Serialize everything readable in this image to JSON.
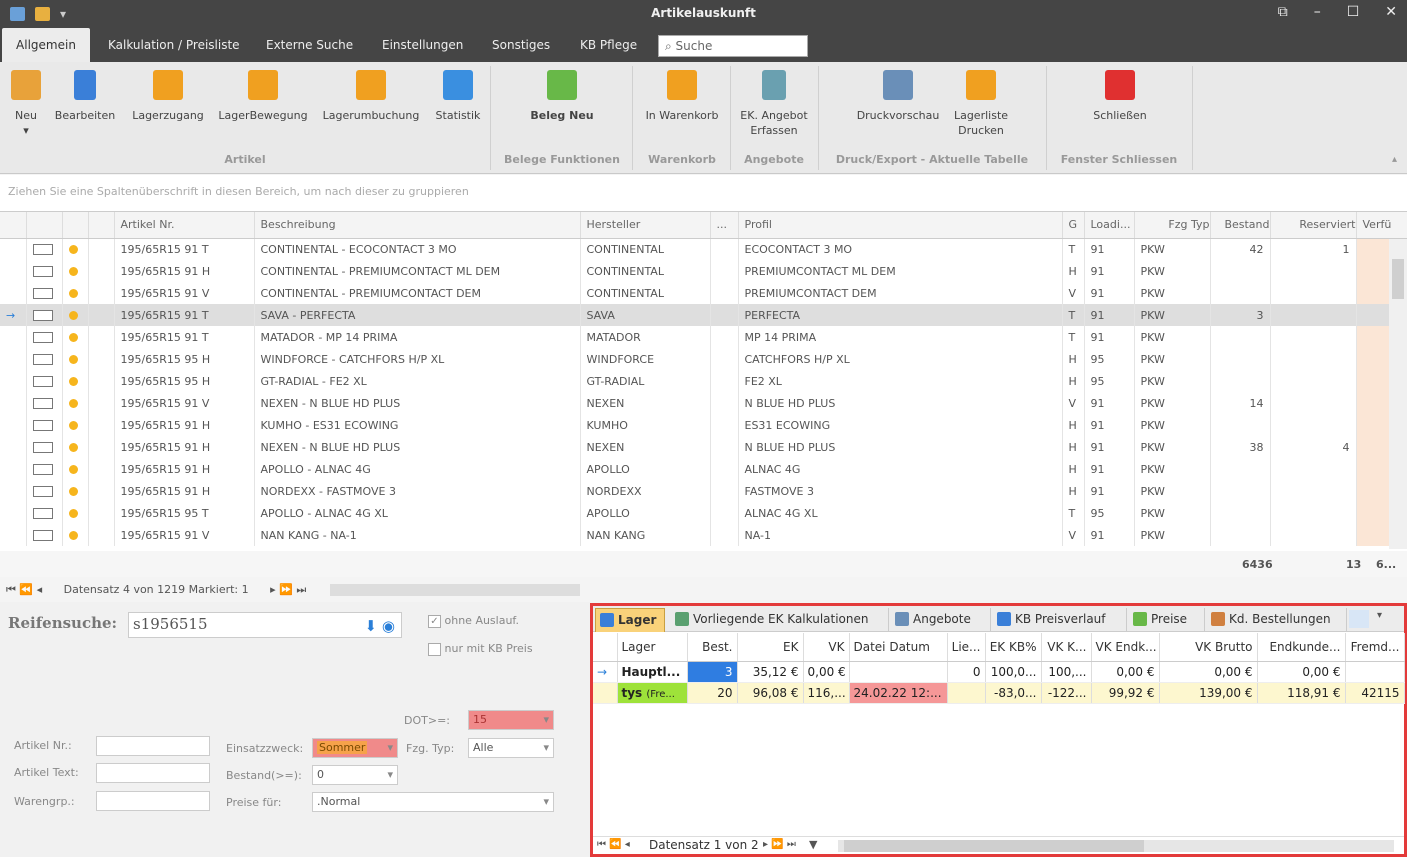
{
  "window": {
    "title": "Artikelauskunft",
    "min": "–",
    "max": "☐",
    "close": "✕",
    "restore": "⧉"
  },
  "menu": {
    "tabs": [
      "Allgemein",
      "Kalkulation / Preisliste",
      "Externe Suche",
      "Einstellungen",
      "Sonstiges",
      "KB Pflege"
    ],
    "search_placeholder": "Suche"
  },
  "ribbon": {
    "buttons": [
      {
        "label": "Neu",
        "color": "#e8a23a"
      },
      {
        "label": "Bearbeiten",
        "color": "#3a7fd8"
      },
      {
        "label": "Lagerzugang",
        "color": "#f0a020"
      },
      {
        "label": "LagerBewegung",
        "color": "#f0a020"
      },
      {
        "label": "Lagerumbuchung",
        "color": "#f0a020"
      },
      {
        "label": "Statistik",
        "color": "#3a8fe0"
      },
      {
        "label": "Beleg Neu",
        "color": "#68b848"
      },
      {
        "label": "In Warenkorb",
        "color": "#f0a020"
      },
      {
        "label": "EK. Angebot Erfassen",
        "color": "#6aa0b0"
      },
      {
        "label": "Druckvorschau",
        "color": "#6a8fb8"
      },
      {
        "label": "Lagerliste Drucken",
        "color": "#f0a020"
      },
      {
        "label": "Schließen",
        "color": "#e03030"
      }
    ],
    "groups": [
      "Artikel",
      "Belege Funktionen",
      "Warenkorb",
      "Angebote",
      "Druck/Export - Aktuelle Tabelle",
      "Fenster Schliessen"
    ]
  },
  "groupbar": "Ziehen Sie eine Spaltenüberschrift in diesen Bereich, um nach dieser zu gruppieren",
  "grid": {
    "columns": [
      "",
      "",
      "",
      "Artikel Nr.",
      "Beschreibung",
      "Hersteller",
      "...",
      "Profil",
      "G",
      "Loadi...",
      "Fzg Typ",
      "Bestand",
      "Reserviert",
      "Verfü"
    ],
    "rows": [
      [
        "195/65R15 91 T",
        "CONTINENTAL - ECOCONTACT 3 MO",
        "CONTINENTAL",
        "ECOCONTACT 3 MO",
        "T",
        "91",
        "PKW",
        "42",
        "1"
      ],
      [
        "195/65R15 91 H",
        "CONTINENTAL - PREMIUMCONTACT ML DEM",
        "CONTINENTAL",
        "PREMIUMCONTACT ML DEM",
        "H",
        "91",
        "PKW",
        "",
        ""
      ],
      [
        "195/65R15 91 V",
        "CONTINENTAL - PREMIUMCONTACT DEM",
        "CONTINENTAL",
        "PREMIUMCONTACT DEM",
        "V",
        "91",
        "PKW",
        "",
        ""
      ],
      [
        "195/65R15 91 T",
        "SAVA - PERFECTA",
        "SAVA",
        "PERFECTA",
        "T",
        "91",
        "PKW",
        "3",
        ""
      ],
      [
        "195/65R15 91 T",
        "MATADOR - MP 14 PRIMA",
        "MATADOR",
        "MP 14 PRIMA",
        "T",
        "91",
        "PKW",
        "",
        ""
      ],
      [
        "195/65R15 95 H",
        "WINDFORCE - CATCHFORS H/P XL",
        "WINDFORCE",
        "CATCHFORS H/P XL",
        "H",
        "95",
        "PKW",
        "",
        ""
      ],
      [
        "195/65R15 95 H",
        "GT-RADIAL - FE2 XL",
        "GT-RADIAL",
        "FE2 XL",
        "H",
        "95",
        "PKW",
        "",
        ""
      ],
      [
        "195/65R15 91 V",
        "NEXEN - N BLUE HD PLUS",
        "NEXEN",
        "N BLUE HD PLUS",
        "V",
        "91",
        "PKW",
        "14",
        ""
      ],
      [
        "195/65R15 91 H",
        "KUMHO - ES31 ECOWING",
        "KUMHO",
        "ES31 ECOWING",
        "H",
        "91",
        "PKW",
        "",
        ""
      ],
      [
        "195/65R15 91 H",
        "NEXEN - N BLUE HD PLUS",
        "NEXEN",
        "N BLUE HD PLUS",
        "H",
        "91",
        "PKW",
        "38",
        "4"
      ],
      [
        "195/65R15 91 H",
        "APOLLO - ALNAC 4G",
        "APOLLO",
        "ALNAC 4G",
        "H",
        "91",
        "PKW",
        "",
        ""
      ],
      [
        "195/65R15 91 H",
        "NORDEXX - FASTMOVE 3",
        "NORDEXX",
        "FASTMOVE 3",
        "H",
        "91",
        "PKW",
        "",
        ""
      ],
      [
        "195/65R15 95 T",
        "APOLLO - ALNAC 4G XL",
        "APOLLO",
        "ALNAC 4G XL",
        "T",
        "95",
        "PKW",
        "",
        ""
      ],
      [
        "195/65R15 91 V",
        "NAN KANG - NA-1",
        "NAN KANG",
        "NA-1",
        "V",
        "91",
        "PKW",
        "",
        ""
      ]
    ],
    "selected_row": 3,
    "totals": {
      "bestand": "6436",
      "reserviert": "13",
      "verf": "6..."
    },
    "nav": "Datensatz 4 von 1219 Markiert: 1"
  },
  "search": {
    "label": "Reifensuche:",
    "value": "s1956515",
    "ohne_auslauf": "ohne Auslauf.",
    "nur_kb": "nur mit KB Preis",
    "dot_label": "DOT>=:",
    "dot_value": "15",
    "artikel_nr": "Artikel Nr.:",
    "artikel_text": "Artikel Text:",
    "warengrp": "Warengrp.:",
    "einsatz_label": "Einsatzzweck:",
    "einsatz_value": "Sommer",
    "fzg_label": "Fzg. Typ:",
    "fzg_value": "Alle",
    "bestand_label": "Bestand(>=):",
    "bestand_value": "0",
    "preise_label": "Preise für:",
    "preise_value": ".Normal"
  },
  "detail": {
    "tabs": [
      {
        "label": "Lager",
        "color": "#3a7fd8"
      },
      {
        "label": "Vorliegende EK Kalkulationen",
        "color": "#5aa070"
      },
      {
        "label": "Angebote",
        "color": "#6a8fb8"
      },
      {
        "label": "KB Preisverlauf",
        "color": "#3a7fd8"
      },
      {
        "label": "Preise",
        "color": "#68b848"
      },
      {
        "label": "Kd. Bestellungen",
        "color": "#d08040"
      }
    ],
    "columns": [
      "",
      "Lager",
      "Best.",
      "EK",
      "VK",
      "Datei Datum",
      "Lie...",
      "EK KB%",
      "VK K...",
      "VK Endk...",
      "VK Brutto",
      "Endkunde...",
      "Fremd..."
    ],
    "rows": [
      [
        "→",
        "Hauptl...",
        "3",
        "35,12 €",
        "0,00 €",
        "",
        "0",
        "100,0...",
        "100,...",
        "0,00 €",
        "0,00 €",
        "0,00 €",
        ""
      ],
      [
        "",
        "tys",
        "20",
        "96,08 €",
        "116,...",
        "24.02.22 12:...",
        "",
        "-83,0...",
        "-122...",
        "99,92 €",
        "139,00 €",
        "118,91 €",
        "42115"
      ]
    ],
    "row2_suffix": "(Fre...",
    "nav": "Datensatz 1 von 2"
  }
}
